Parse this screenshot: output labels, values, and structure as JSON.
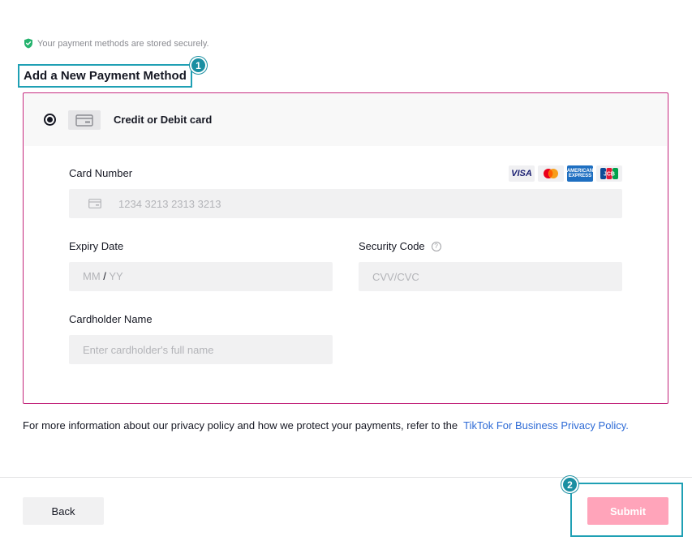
{
  "secure_note": {
    "text": "Your payment methods are stored securely.",
    "icon": "shield-check-icon",
    "icon_color": "#25b36e"
  },
  "title": "Add a New Payment Method",
  "markers": [
    "1",
    "2"
  ],
  "method": {
    "label": "Credit or Debit card",
    "selected": true
  },
  "card_logos": [
    "VISA",
    "Mastercard",
    "AMERICAN EXPRESS",
    "JCB"
  ],
  "form": {
    "card_number": {
      "label": "Card Number",
      "placeholder": "1234 3213 2313 3213"
    },
    "expiry": {
      "label": "Expiry Date",
      "placeholder_month": "MM",
      "separator": "/",
      "placeholder_year": "YY"
    },
    "security_code": {
      "label": "Security Code",
      "placeholder": "CVV/CVC"
    },
    "cardholder": {
      "label": "Cardholder Name",
      "placeholder": "Enter cardholder's full name"
    }
  },
  "privacy": {
    "text": "For more information about our privacy policy and how we protect your payments, refer to the",
    "link": "TikTok For Business Privacy Policy."
  },
  "footer": {
    "back_label": "Back",
    "submit_label": "Submit"
  },
  "colors": {
    "accent_border": "#c2247a",
    "submit_bg": "#ffa4ba",
    "link": "#2e6bd6",
    "highlight": "#1fa0b4"
  }
}
